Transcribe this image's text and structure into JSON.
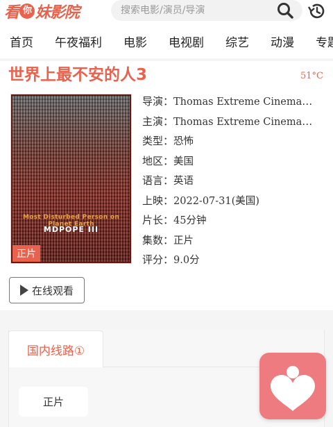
{
  "header": {
    "logo_text_a": "看",
    "logo_text_mid": "你",
    "logo_text_b": "妹影院",
    "search_placeholder": "搜索电影/演员/导演",
    "search_icon": "search-icon",
    "history_icon": "history-icon"
  },
  "nav": {
    "items": [
      {
        "label": "首页"
      },
      {
        "label": "午夜福利"
      },
      {
        "label": "电影"
      },
      {
        "label": "电视剧"
      },
      {
        "label": "综艺"
      },
      {
        "label": "动漫"
      },
      {
        "label": "专题"
      }
    ]
  },
  "movie": {
    "title": "世界上最不安的人3",
    "temperature": "51°C",
    "poster_headline": "Most Disturbed Person on Planet Earth",
    "poster_subtitle": "MDPOPE III",
    "poster_badge": "正片",
    "info": [
      {
        "key": "导演：",
        "value": "Thomas Extreme Cinemag…"
      },
      {
        "key": "主演：",
        "value": "Thomas Extreme Cinemag…"
      },
      {
        "key": "类型：",
        "value": "恐怖"
      },
      {
        "key": "地区：",
        "value": "美国"
      },
      {
        "key": "语言：",
        "value": "英语"
      },
      {
        "key": "上映：",
        "value": "2022-07-31(美国)"
      },
      {
        "key": "片长：",
        "value": "45分钟"
      },
      {
        "key": "集数：",
        "value": "正片"
      },
      {
        "key": "评分：",
        "value": "9.0分"
      }
    ],
    "watch_button": "在线观看"
  },
  "playlist": {
    "tab_label": "国内线路①",
    "episodes": [
      {
        "label": "正片"
      }
    ]
  },
  "colors": {
    "accent": "#e8624d",
    "fab": "#ee7b7f"
  }
}
